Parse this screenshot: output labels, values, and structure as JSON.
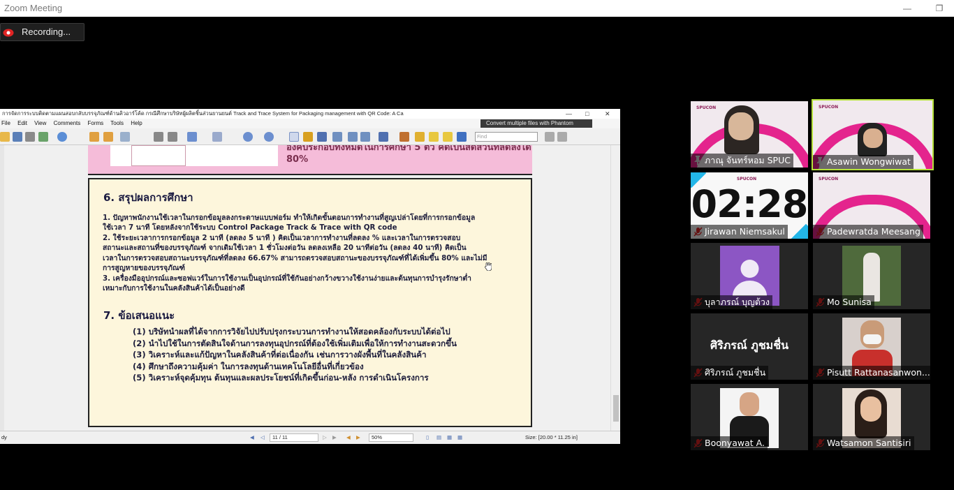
{
  "window": {
    "title": "Zoom Meeting",
    "recording_label": "Recording..."
  },
  "pdf": {
    "title": "การจัดการระบบติดตามแผนสอบกลับบรรจุภัณฑ์ด้านคิวอาร์โค้ด กรณีศึกษาบริษัทผู้ผลิตชิ้นส่วนยานยนต์ Track and Trace System for Packaging management with QR Code: A Ca",
    "menu": [
      "File",
      "Edit",
      "View",
      "Comments",
      "Forms",
      "Tools",
      "Help"
    ],
    "promo": "Convert multiple files with Phantom",
    "find_placeholder": "Find",
    "status": {
      "ready": "dy",
      "page": "11 / 11",
      "zoom": "50%",
      "size": "Size: [20.00 * 11.25 in]"
    },
    "partial_top_text": "องค์ประกอบทั้งหมดในการศึกษา 5 ตัว คิดเป็นสัดส่วนที่ลดลงได้ 80%"
  },
  "slide": {
    "section6_title": "6. สรุปผลการศึกษา",
    "section6_lines": [
      "1. ปัญหาพนักงานใช้เวลาในกรอกข้อมูลลงกระดาษแบบฟอร์ม ทำให้เกิดขั้นตอนการทำงานที่สูญเปล่าโดยที่การกรอกข้อมูล",
      "ใช้เวลา 7 นาที โดยหลังจากใช้ระบบ Control Package Track & Trace with QR code",
      "2. ใช้ระยะเวลาการกรอกข้อมูล 2 นาที (ลดลง 5 นาที ) คิดเป็นเวลาการทำงานที่ลดลง  % และเวลาในการตรวจสอบ",
      "สถานะและสถานที่ของบรรจุภัณฑ์ จากเดิมใช้เวลา 1 ชั่วโมงต่อวัน ลดลงเหลือ 20 นาทีต่อวัน (ลดลง 40 นาที) คิดเป็น",
      "เวลาในการตรวจสอบสถานะบรรจุภัณฑ์ที่ลดลง 66.67% สามารถตรวจสอบสถานะของบรรจุภัณฑ์ที่ได้เพิ่มขึ้น 80% และไม่มี",
      "การสูญหายของบรรจุภัณฑ์",
      "3. เครื่องมืออุปกรณ์และซอฟแวร์ในการใช้งานเป็นอุปกรณ์ที่ใช้กันอย่างกว้างขวางใช้งานง่ายและต้นทุนการบำรุงรักษาต่ำ",
      "เหมาะกับการใช้งานในคลังสินค้าได้เป็นอย่างดี"
    ],
    "section7_title": "7. ข้อเสนอแนะ",
    "section7_items": [
      "(1) บริษัทนำผลที่ได้จากการวิจัยไปปรับปรุงกระบวนการทำงานให้สอดคล้องกับระบบได้ต่อไป",
      "(2) นำไปใช้ในการตัดสินใจด้านการลงทุนอุปกรณ์ที่ต้องใช้เพิ่มเติมเพื่อให้การทำงานสะดวกขึ้น",
      "(3) วิเคราะห์และแก้ปัญหาในคลังสินค้าที่ต่อเนื่องกัน เช่นการวางผังพื้นที่ในคลังสินค้า",
      "(4) ศึกษาถึงความคุ้มค่า ในการลงทุนด้านเทคโนโลยีอื่นที่เกี่ยวข้อง",
      "(5) วิเคราะห์จุดคุ้มทุน ต้นทุนและผลประโยชน์ที่เกิดขึ้นก่อน-หลัง การดำเนินโครงการ"
    ]
  },
  "participants": [
    {
      "name": "ภาณุ จันทร์หอม SPUC",
      "pinned": true,
      "muted": false
    },
    {
      "name": "Asawin Wongwiwat",
      "pinned": true,
      "muted": false,
      "active": true
    },
    {
      "name": "Jirawan Niemsakul",
      "muted": true,
      "timer": "02:28"
    },
    {
      "name": "Padewratda Meesang",
      "muted": true
    },
    {
      "name": "บุลาภรณ์ บุญต้วง",
      "muted": true
    },
    {
      "name": "Mo Sunisa",
      "muted": true
    },
    {
      "name": "ศิริภรณ์ ภูชมชื่น",
      "muted": true,
      "big_label": "ศิริภรณ์ ภูชมชื่น"
    },
    {
      "name": "Pisutt Rattanasanwon...",
      "muted": true
    },
    {
      "name": "Boonyawat A.",
      "muted": true
    },
    {
      "name": "Watsamon Santisiri",
      "muted": true
    }
  ],
  "colors": {
    "active_border": "#b6e23a",
    "spucon_pink": "#e4248d",
    "slide_bg": "#fdf6dc"
  }
}
